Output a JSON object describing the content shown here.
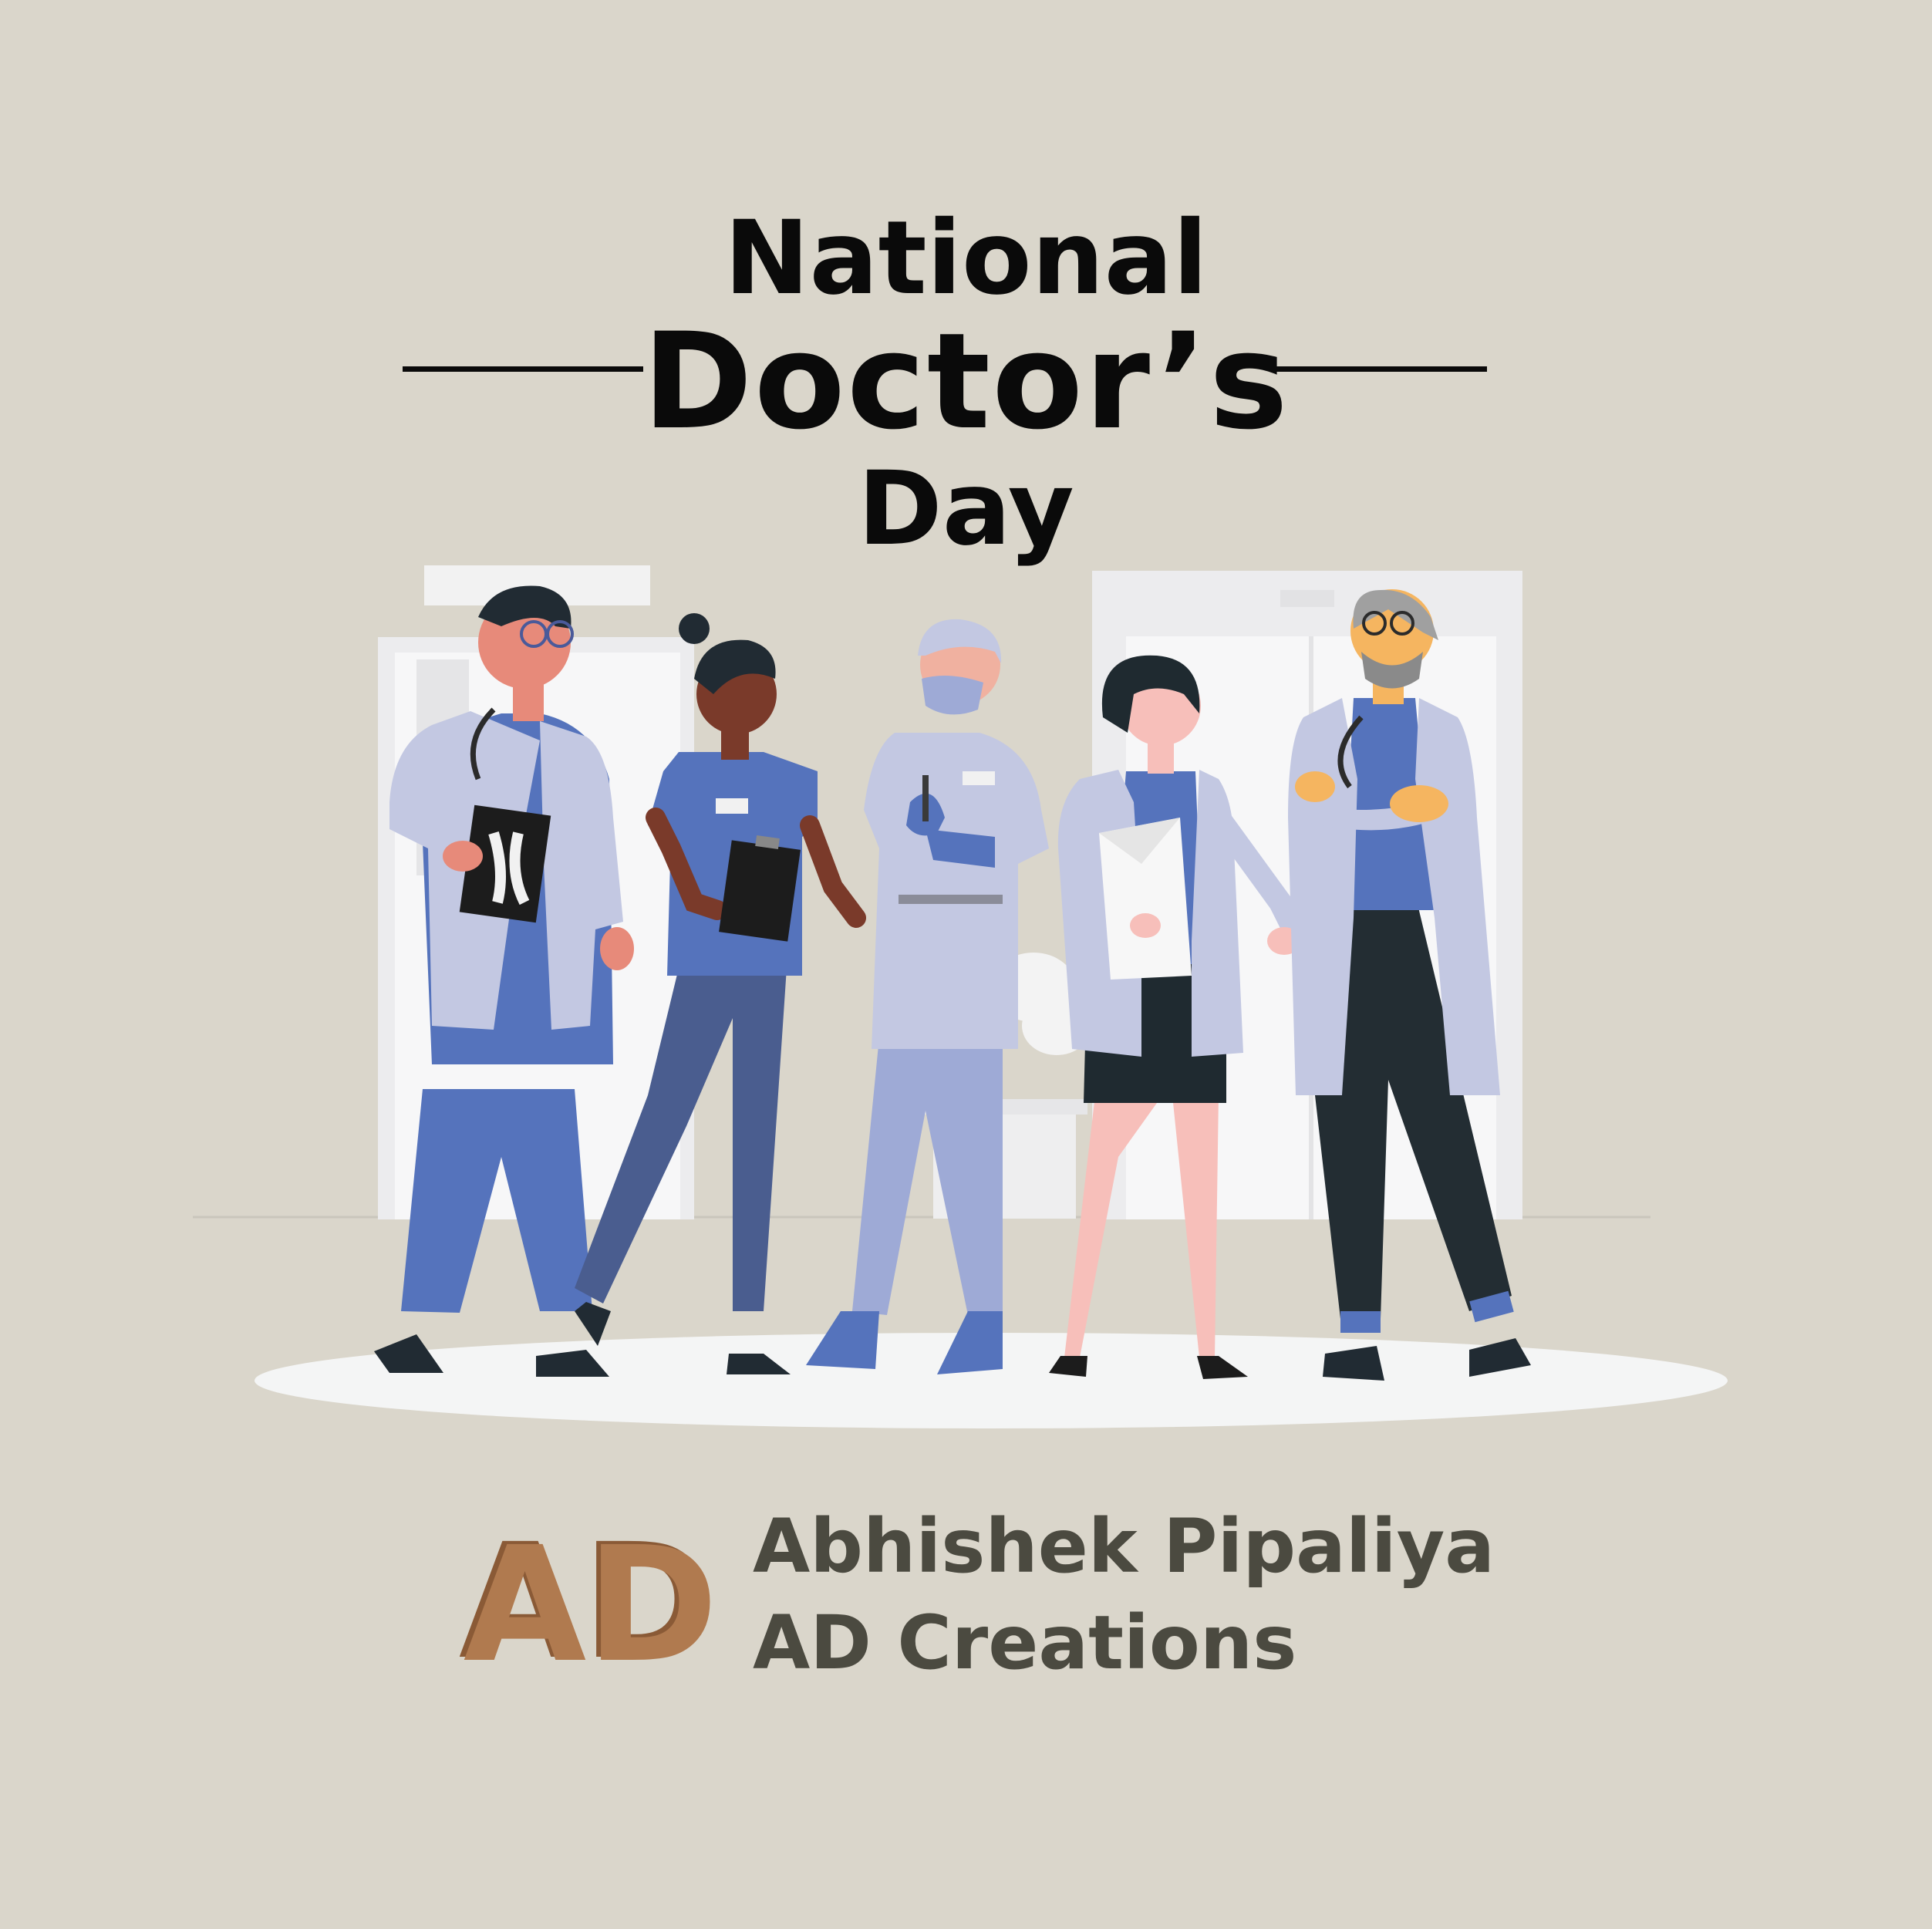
{
  "title": {
    "line1": "National",
    "line2": "Doctor’s",
    "line3": "Day"
  },
  "brand": {
    "logo_text": "AD",
    "name": "Abhishek Pipaliya",
    "company": "AD Creations"
  },
  "colors": {
    "background": "#dad6cb",
    "title_text": "#0a0a0a",
    "brand_text": "#4b4a40",
    "logo_copper": "#b07a4f",
    "logo_shadow": "#8a5a36",
    "scrub_blue": "#5573bc",
    "coat_lavender": "#c3c8e2",
    "floor_white": "#f4f5f5"
  }
}
